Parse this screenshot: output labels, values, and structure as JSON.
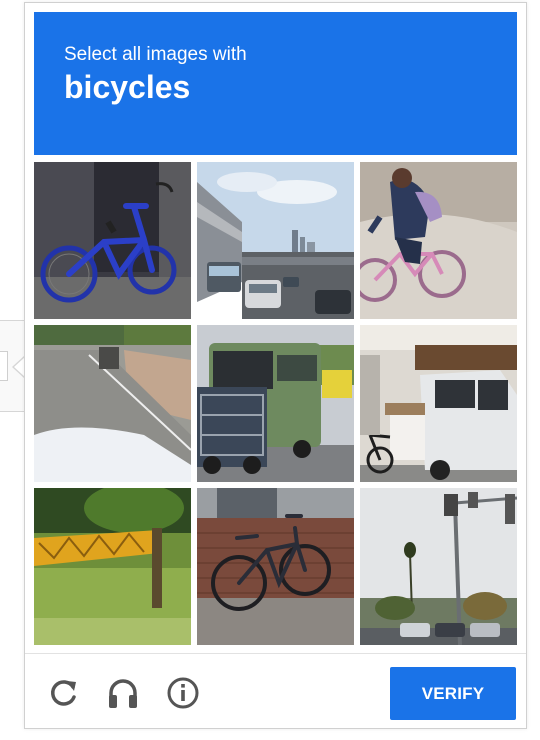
{
  "challenge": {
    "instruction": "Select all images with",
    "target": "bicycles"
  },
  "tiles": [
    {
      "name": "tile-1",
      "subject": "blue bicycle parked against dark wall"
    },
    {
      "name": "tile-2",
      "subject": "highway traffic with city skyline"
    },
    {
      "name": "tile-3",
      "subject": "person riding small pink bicycle"
    },
    {
      "name": "tile-4",
      "subject": "road beside wall and shrubs"
    },
    {
      "name": "tile-5",
      "subject": "bus and truck on street"
    },
    {
      "name": "tile-6",
      "subject": "white van and bicycle near building"
    },
    {
      "name": "tile-7",
      "subject": "yellow structure in overgrown grass"
    },
    {
      "name": "tile-8",
      "subject": "bicycle leaning on brick wall"
    },
    {
      "name": "tile-9",
      "subject": "traffic light and palm trees"
    }
  ],
  "footer": {
    "icons": [
      "reload-icon",
      "headphones-icon",
      "info-icon"
    ],
    "verify_label": "VERIFY"
  },
  "colors": {
    "accent": "#1a73e8",
    "icon": "#555555"
  }
}
